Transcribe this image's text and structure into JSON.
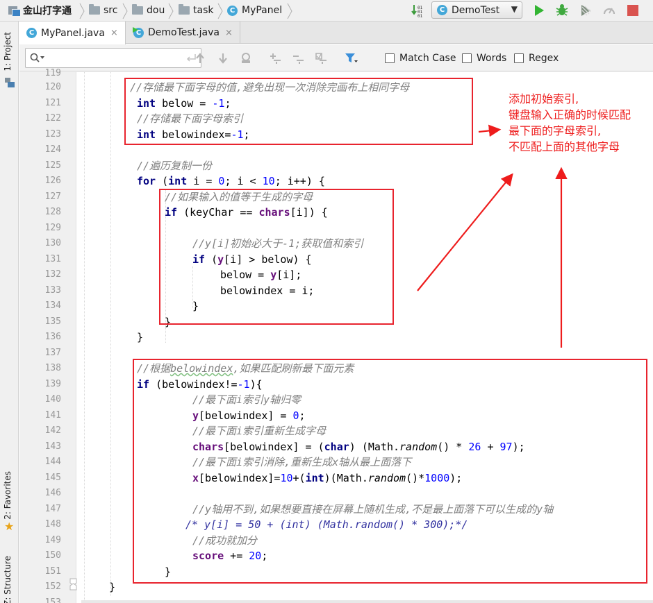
{
  "breadcrumb": [
    "金山打字通",
    "src",
    "dou",
    "task",
    "MyPanel"
  ],
  "run_config": "DemoTest",
  "tabs": [
    {
      "label": "MyPanel.java",
      "close": "×"
    },
    {
      "label": "DemoTest.java",
      "close": "×"
    }
  ],
  "search": {
    "placeholder": "",
    "match_case": "Match Case",
    "words": "Words",
    "regex": "Regex"
  },
  "tool_windows": {
    "project": "1: Project",
    "favorites": "2: Favorites",
    "structure": "Z: Structure"
  },
  "annotation": [
    "添加初始索引,",
    "键盘输入正确的时候匹配",
    "最下面的字母索引,",
    "不匹配上面的其他字母"
  ],
  "code": {
    "line_numbers": [
      "119",
      "120",
      "121",
      "122",
      "123",
      "124",
      "125",
      "126",
      "127",
      "128",
      "129",
      "130",
      "131",
      "132",
      "133",
      "134",
      "135",
      "136",
      "137",
      "138",
      "139",
      "140",
      "141",
      "142",
      "143",
      "144",
      "145",
      "146",
      "147",
      "148",
      "149",
      "150",
      "151",
      "152",
      "153"
    ],
    "line_120": "//存储最下面字母的值,避免出现一次消除完画布上相同字母",
    "line_121": [
      "int",
      " below = ",
      "-1",
      ";"
    ],
    "line_122": "//存储最下面字母索引",
    "line_123": [
      "int",
      " belowindex=",
      "-1",
      ";"
    ],
    "line_125": "//遍历复制一份",
    "line_126": [
      "for",
      " (",
      "int",
      " i = ",
      "0",
      "; i < ",
      "10",
      "; i++) {"
    ],
    "line_127": "//如果输入的值等于生成的字母",
    "line_128": [
      "if",
      " (keyChar == ",
      "chars",
      "[i]) {"
    ],
    "line_130": "//y[i]初始必大于-1;获取值和索引",
    "line_131": [
      "if",
      " (",
      "y",
      "[i] > below) {"
    ],
    "line_132": [
      "below = ",
      "y",
      "[i];"
    ],
    "line_133": "belowindex = i;",
    "line_134": "}",
    "line_135": "}",
    "line_136": "}",
    "line_138_a": "//根据",
    "line_138_b": "belowindex",
    "line_138_c": ",如果匹配刷新最下面元素",
    "line_139": [
      "if",
      " (belowindex!=",
      "-1",
      "){"
    ],
    "line_140": "//最下面i索引y轴归零",
    "line_141": [
      "y",
      "[belowindex] = ",
      "0",
      ";"
    ],
    "line_142": "//最下面i索引重新生成字母",
    "line_143": [
      "chars",
      "[belowindex] = (",
      "char",
      ") (Math.",
      "random",
      "() * ",
      "26",
      " + ",
      "97",
      ");"
    ],
    "line_144": "//最下面i索引消除,重新生成x轴从最上面落下",
    "line_145": [
      "x",
      "[belowindex]=",
      "10",
      "+(",
      "int",
      ")(Math.",
      "random",
      "()*",
      "1000",
      ");"
    ],
    "line_147": "//y轴用不到,如果想要直接在屏幕上随机生成,不是最上面落下可以生成的y轴",
    "line_148": "/* y[i] = 50 + (int) (Math.random() * 300);*/",
    "line_149": "//成功就加分",
    "line_150": [
      "score",
      " += ",
      "20",
      ";"
    ],
    "line_151": "}",
    "line_152": "}"
  },
  "colors": {
    "annotation_red": "#e8242e",
    "keyword": "#000080",
    "number": "#0000ff",
    "comment": "#808080",
    "field": "#660e7a"
  },
  "icons": [
    "folder-icon",
    "class-icon",
    "vcs-update-icon",
    "run-icon",
    "debug-icon",
    "coverage-icon",
    "profile-icon",
    "stop-icon",
    "search-icon",
    "enter-icon",
    "arrow-up-icon",
    "arrow-down-icon",
    "find-usages-icon",
    "add-occurrence-icon",
    "remove-occurrence-icon",
    "select-all-occurrences-icon",
    "filter-icon"
  ]
}
